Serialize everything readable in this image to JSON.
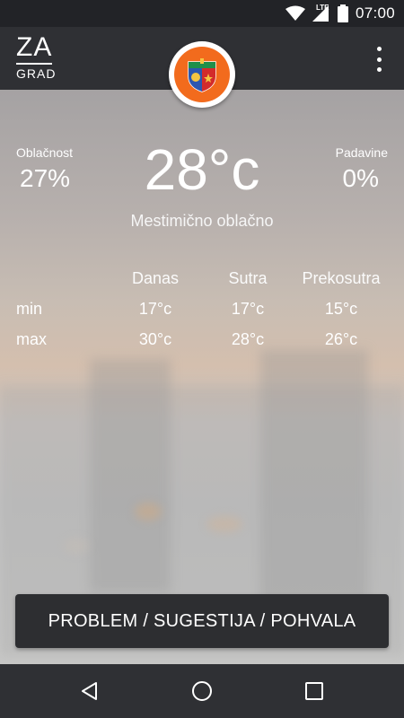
{
  "status_bar": {
    "time": "07:00",
    "network_label": "LTE",
    "icons": [
      "wifi-icon",
      "signal-icon",
      "battery-icon"
    ]
  },
  "app_bar": {
    "logo_top": "ZA",
    "logo_bottom": "GRAD",
    "crest_icon": "city-crest-icon",
    "menu_icon": "overflow-menu-icon"
  },
  "weather": {
    "cloudiness_label": "Oblačnost",
    "cloudiness_value": "27%",
    "temperature": "28°c",
    "description": "Mestimično oblačno",
    "precip_label": "Padavine",
    "precip_value": "0%"
  },
  "forecast": {
    "columns": [
      "Danas",
      "Sutra",
      "Prekosutra"
    ],
    "rows": [
      {
        "label": "min",
        "values": [
          "17°c",
          "17°c",
          "15°c"
        ]
      },
      {
        "label": "max",
        "values": [
          "30°c",
          "28°c",
          "26°c"
        ]
      }
    ]
  },
  "action_button": {
    "label": "PROBLEM / SUGESTIJA / POHVALA"
  },
  "nav_bar": {
    "back_icon": "back-triangle-icon",
    "home_icon": "home-circle-icon",
    "recents_icon": "recents-square-icon"
  },
  "colors": {
    "app_bar": "#2f3034",
    "status_bar": "#222327",
    "crest_orange": "#f26b1d",
    "button": "#2d2e31"
  }
}
